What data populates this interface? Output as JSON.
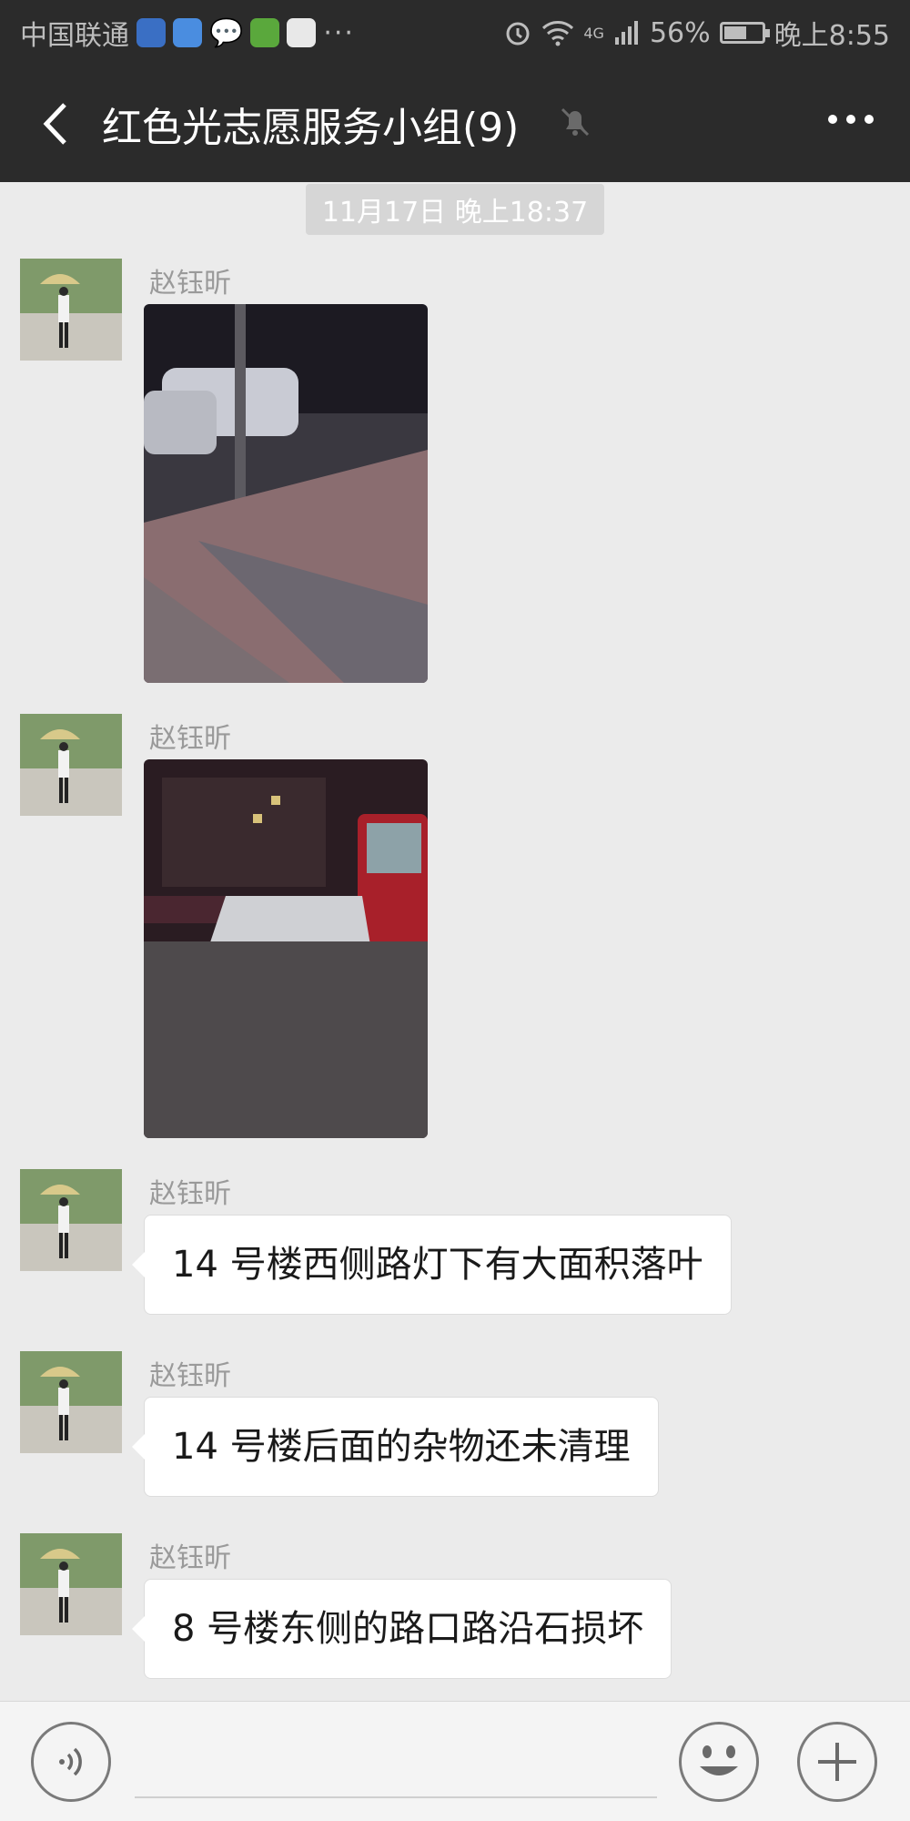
{
  "status_bar": {
    "carrier": "中国联通",
    "more_glyph": "···",
    "network": "4G",
    "battery": "56%",
    "battery_level": 0.56,
    "time": "晚上8:55"
  },
  "header": {
    "title": "红色光志愿服务小组(9)",
    "muted": true
  },
  "timestamp": "11月17日 晚上18:37",
  "messages": [
    {
      "sender": "赵钰昕",
      "type": "image",
      "image_desc": "night-street-leaves"
    },
    {
      "sender": "赵钰昕",
      "type": "image",
      "image_desc": "night-debris"
    },
    {
      "sender": "赵钰昕",
      "type": "text",
      "text": "14 号楼西侧路灯下有大面积落叶"
    },
    {
      "sender": "赵钰昕",
      "type": "text",
      "text": "14 号楼后面的杂物还未清理"
    },
    {
      "sender": "赵钰昕",
      "type": "text",
      "text": "8 号楼东侧的路口路沿石损坏"
    }
  ],
  "input": {
    "value": "",
    "placeholder": ""
  },
  "colors": {
    "bar_bg": "#2b2b2b",
    "chat_bg": "#ebebeb",
    "bubble_bg": "#ffffff",
    "timestamp_bg": "#d6d6d6",
    "sender_text": "#9a9a9a"
  },
  "icons": [
    "back-chevron-icon",
    "mute-bell-icon",
    "more-icon",
    "voice-icon",
    "emoji-icon",
    "plus-icon"
  ]
}
